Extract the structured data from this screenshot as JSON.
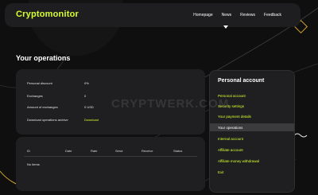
{
  "header": {
    "logo": "Cryptomonitor",
    "nav": [
      "Homepage",
      "News",
      "Reviews",
      "Feedback"
    ]
  },
  "page": {
    "title": "Your operations"
  },
  "operations": {
    "rows": [
      {
        "label": "Personal discount",
        "value": "0%"
      },
      {
        "label": "Exchanges",
        "value": "0"
      },
      {
        "label": "Amount of exchanges",
        "value": "0 USD"
      },
      {
        "label": "Download operations archive",
        "value": "Download"
      }
    ]
  },
  "table": {
    "columns": [
      "ID",
      "Date",
      "Rate",
      "Send",
      "Receive",
      "Status"
    ],
    "empty": "No items"
  },
  "account": {
    "title": "Personal account",
    "items": [
      "Personal account",
      "Security settings",
      "Your payment details",
      "Your operations",
      "Internal account",
      "Affiliate account",
      "Affiliate money withdrawal",
      "Exit"
    ],
    "active_index": 3
  },
  "watermark": "CRYPTWERK.COM",
  "colors": {
    "accent": "#d7ff2e",
    "background": "#0f0f10",
    "card": "#1f1f21"
  }
}
